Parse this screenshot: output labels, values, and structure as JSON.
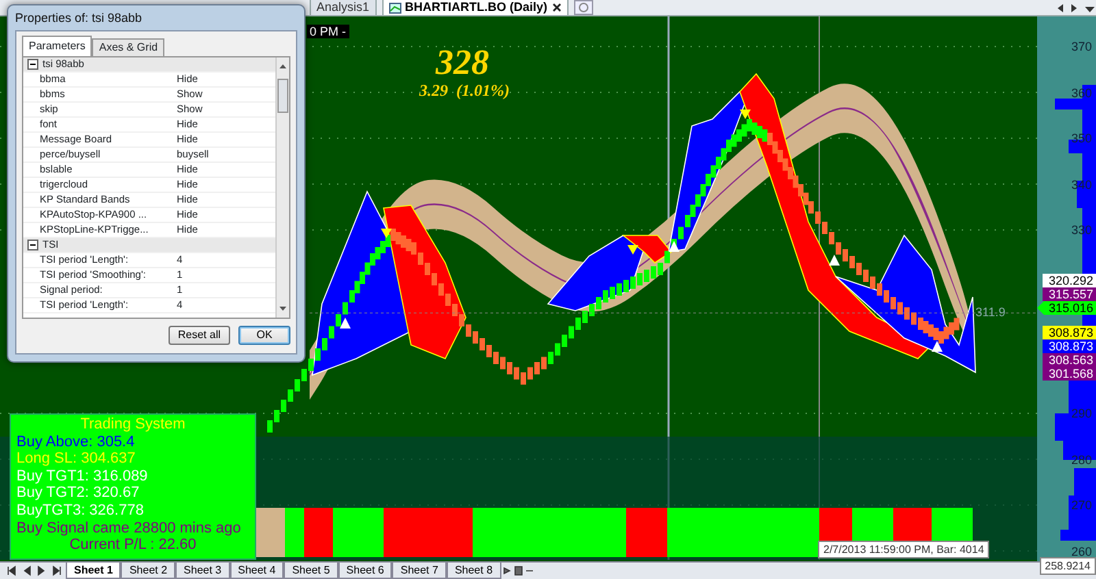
{
  "top_tabs": [
    {
      "label": "Analysis1",
      "selected": false,
      "closable": false
    },
    {
      "label": "BHARTIARTL.BO (Daily)",
      "selected": true,
      "closable": true
    }
  ],
  "chart": {
    "time_fragment": "0 PM -",
    "price": "328",
    "change": "3.29  (1.01%)",
    "last_label": "311.9",
    "axis_labels": [
      "370",
      "360",
      "350",
      "340",
      "330",
      "290",
      "280",
      "270",
      "260"
    ],
    "price_tags": [
      {
        "value": "320.292",
        "color": "#ffffff",
        "pointer": false
      },
      {
        "value": "315.557",
        "color": "#800080",
        "pointer": false
      },
      {
        "value": "315.016",
        "color": "#00ff00",
        "pointer": true
      },
      {
        "value": "308.873",
        "color": "#ffff00",
        "pointer": false
      },
      {
        "value": "308.873",
        "color": "#0000ff",
        "pointer": false
      },
      {
        "value": "308.563",
        "color": "#800080",
        "pointer": false
      },
      {
        "value": "301.568",
        "color": "#800080",
        "pointer": false
      }
    ],
    "cursor_tooltip": "2/7/2013 11:59:00 PM, Bar: 4014",
    "axis_cursor": "258.9214"
  },
  "dialog": {
    "title": "Properties of: tsi 98abb",
    "tabs": [
      {
        "label": "Parameters",
        "selected": true
      },
      {
        "label": "Axes & Grid",
        "selected": false
      }
    ],
    "rows": [
      {
        "kind": "group",
        "name": "tsi 98abb",
        "expanded": true
      },
      {
        "kind": "property",
        "name": "bbma",
        "value": "Hide"
      },
      {
        "kind": "property",
        "name": "bbms",
        "value": "Show"
      },
      {
        "kind": "property",
        "name": "skip",
        "value": "Show"
      },
      {
        "kind": "property",
        "name": "font",
        "value": "Hide"
      },
      {
        "kind": "property",
        "name": "Message Board",
        "value": "Hide"
      },
      {
        "kind": "property",
        "name": "perce/buysell",
        "value": "buysell"
      },
      {
        "kind": "property",
        "name": "bslable",
        "value": "Hide"
      },
      {
        "kind": "property",
        "name": "trigercloud",
        "value": "Hide"
      },
      {
        "kind": "property",
        "name": "KP Standard  Bands",
        "value": "Hide"
      },
      {
        "kind": "property",
        "name": "KPAutoStop-KPA900 ...",
        "value": "Hide"
      },
      {
        "kind": "property",
        "name": "KPStopLine-KPTrigge...",
        "value": "Hide"
      },
      {
        "kind": "group",
        "name": "TSI",
        "expanded": true
      },
      {
        "kind": "property",
        "name": "TSI period 'Length':",
        "value": "4"
      },
      {
        "kind": "property",
        "name": "TSI period 'Smoothing':",
        "value": "1"
      },
      {
        "kind": "property",
        "name": "Signal period:",
        "value": "1"
      },
      {
        "kind": "property",
        "name": "TSI period 'Length':",
        "value": "4"
      }
    ],
    "buttons": [
      {
        "label": "Reset all",
        "default": false
      },
      {
        "label": "OK",
        "default": true
      }
    ]
  },
  "trading_system": {
    "lines": [
      {
        "text": "Trading System",
        "color": "#ffff00",
        "centered": true
      },
      {
        "text": "Buy Above: 305.4",
        "color": "#0000ff",
        "centered": false
      },
      {
        "text": "Long SL: 304.637",
        "color": "#ffff00",
        "centered": false
      },
      {
        "text": "Buy TGT1: 316.089",
        "color": "#ffffff",
        "centered": false
      },
      {
        "text": "Buy TGT2: 320.67",
        "color": "#ffffff",
        "centered": false
      },
      {
        "text": "BuyTGT3: 326.778",
        "color": "#ffffff",
        "centered": false
      },
      {
        "text": "Buy  Signal came 28800 mins ago",
        "color": "#800080",
        "centered": false
      },
      {
        "text": "Current P/L : 22.60",
        "color": "#800080",
        "centered": true
      }
    ]
  },
  "sheet_tabs": [
    {
      "label": "Sheet 1",
      "selected": true
    },
    {
      "label": "Sheet 2",
      "selected": false
    },
    {
      "label": "Sheet 3",
      "selected": false
    },
    {
      "label": "Sheet 4",
      "selected": false
    },
    {
      "label": "Sheet 5",
      "selected": false
    },
    {
      "label": "Sheet 6",
      "selected": false
    },
    {
      "label": "Sheet 7",
      "selected": false
    },
    {
      "label": "Sheet 8",
      "selected": false
    }
  ]
}
